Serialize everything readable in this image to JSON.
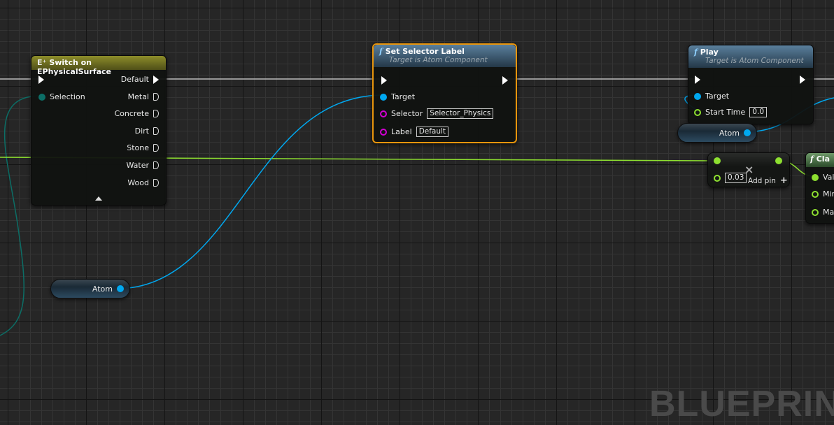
{
  "colors": {
    "exec": "#ffffff",
    "object": "#00a8f0",
    "float": "#8ee030",
    "name": "#d400d4",
    "enum": "#0c6e66",
    "selected": "#e8950c"
  },
  "switch_node": {
    "title": "Switch on EPhysicalSurface",
    "icon": "switch-enum-icon",
    "input": "Selection",
    "outputs": [
      "Default",
      "Metal",
      "Concrete",
      "Dirt",
      "Stone",
      "Water",
      "Wood"
    ]
  },
  "set_label_node": {
    "title": "Set Selector Label",
    "subtitle": "Target is Atom Component",
    "pins": {
      "target": "Target",
      "selector": "Selector",
      "selector_value": "Selector_Physics",
      "label": "Label",
      "label_value": "Default"
    }
  },
  "play_node": {
    "title": "Play",
    "subtitle": "Target is Atom Component",
    "pins": {
      "target": "Target",
      "start_time": "Start Time",
      "start_time_value": "0.0"
    }
  },
  "atom_var_left": {
    "label": "Atom"
  },
  "atom_var_right": {
    "label": "Atom"
  },
  "add_node": {
    "value": "0.03",
    "add_pin": "Add pin"
  },
  "clamp_node": {
    "title": "Cla",
    "pins": [
      "Val",
      "Min",
      "Ma"
    ]
  },
  "watermark": "BLUEPRINT"
}
